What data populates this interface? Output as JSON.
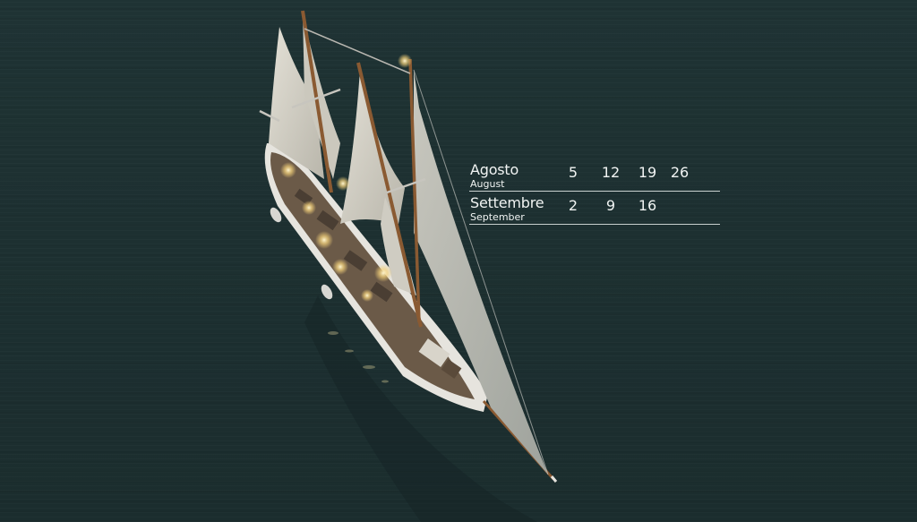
{
  "schedule": {
    "rows": [
      {
        "month": "Agosto",
        "month_en": "August",
        "days": [
          "5",
          "12",
          "19",
          "26"
        ]
      },
      {
        "month": "Settembre",
        "month_en": "September",
        "days": [
          "2",
          "9",
          "16"
        ]
      }
    ]
  },
  "colors": {
    "water": "#1d3031",
    "sail": "#d9d6cc",
    "hull": "#e6e4de",
    "deck": "#6b5a48",
    "mast": "#8a5a32",
    "text": "#f1f4f3"
  }
}
